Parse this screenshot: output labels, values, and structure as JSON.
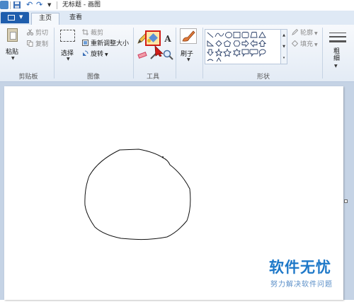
{
  "window": {
    "title": "无标题 - 画图"
  },
  "quick_access": {
    "icons": [
      "save-icon",
      "undo-icon",
      "redo-icon",
      "customize-icon"
    ]
  },
  "tabs": {
    "home": "主页",
    "view": "查看"
  },
  "ribbon": {
    "clipboard": {
      "label": "剪贴板",
      "paste": "粘贴",
      "cut": "剪切",
      "copy": "复制"
    },
    "image": {
      "label": "图像",
      "select": "选择",
      "crop": "裁剪",
      "resize": "重新调整大小",
      "rotate": "旋转"
    },
    "tools": {
      "label": "工具",
      "active_tool": "fill-with-color"
    },
    "brush": {
      "label": "刷子"
    },
    "shapes": {
      "label": "形状",
      "outline": "轮廓",
      "fill": "填充"
    },
    "size": {
      "label": "粗细"
    }
  },
  "watermark": {
    "logo": "软件无忧",
    "subtitle": "努力解决软件问题"
  },
  "colors": {
    "file_tab": "#1f5ead",
    "highlight": "#d21d17",
    "canvas": "#ffffff",
    "workspace": "#c5d3e5"
  }
}
